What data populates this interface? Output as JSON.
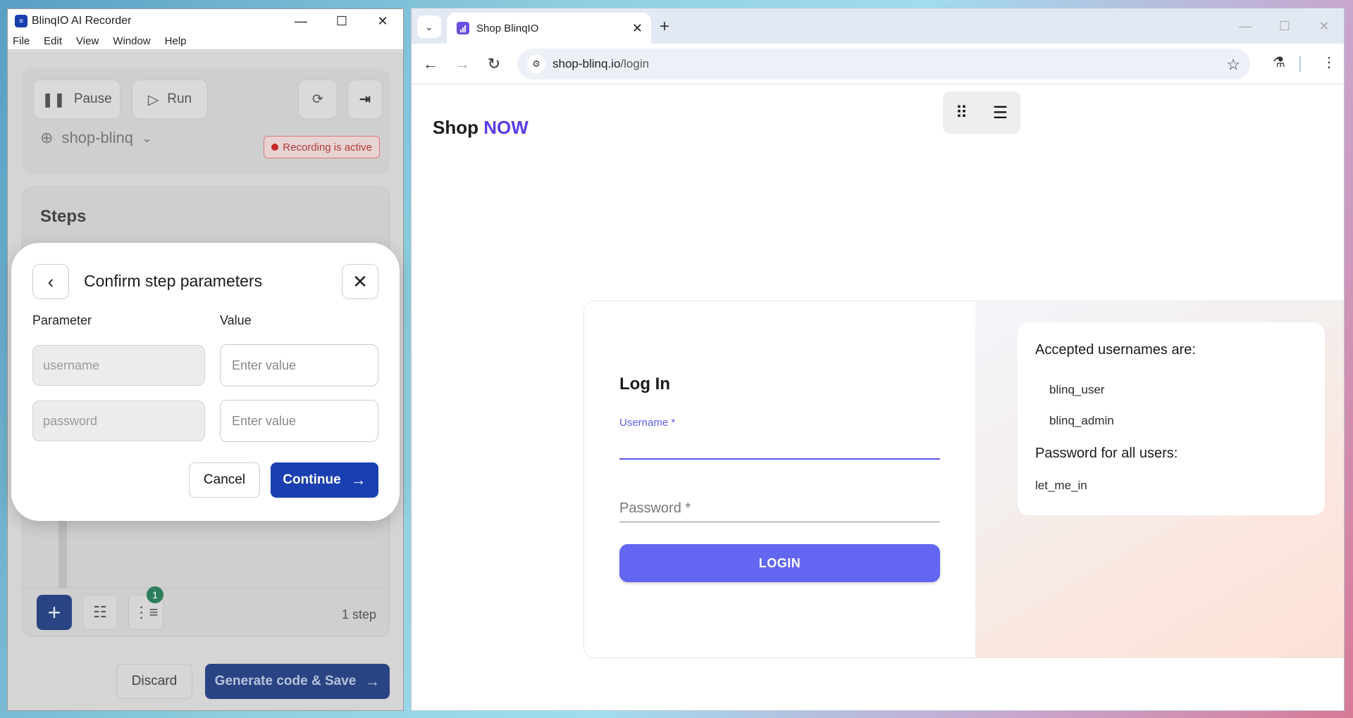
{
  "recorder": {
    "title": "BlinqIO AI Recorder",
    "menu": [
      "File",
      "Edit",
      "View",
      "Window",
      "Help"
    ],
    "pause_label": "Pause",
    "run_label": "Run",
    "project_name": "shop-blinq",
    "recording_status": "Recording is active",
    "steps_title": "Steps",
    "badge_count": "1",
    "step_count": "1 step",
    "discard_label": "Discard",
    "generate_label": "Generate code & Save"
  },
  "modal": {
    "title": "Confirm step parameters",
    "param_header": "Parameter",
    "value_header": "Value",
    "rows": [
      {
        "param": "username",
        "placeholder": "Enter value"
      },
      {
        "param": "password",
        "placeholder": "Enter value"
      }
    ],
    "cancel_label": "Cancel",
    "continue_label": "Continue"
  },
  "browser": {
    "tab_title": "Shop BlinqIO",
    "url_host": "shop-blinq.io",
    "url_path": "/login"
  },
  "page": {
    "brand_main": "Shop",
    "brand_accent": "NOW",
    "login_title": "Log In",
    "username_label": "Username *",
    "password_label": "Password *",
    "login_button": "LOGIN",
    "info_heading": "Accepted usernames are:",
    "usernames": [
      "blinq_user",
      "blinq_admin"
    ],
    "password_heading": "Password for all users:",
    "password_value": "let_me_in"
  },
  "colors": {
    "accent_blue": "#1a3fb0",
    "login_purple": "#6366f1",
    "brand_accent": "#5a3de6",
    "recording_red": "#c62828"
  }
}
